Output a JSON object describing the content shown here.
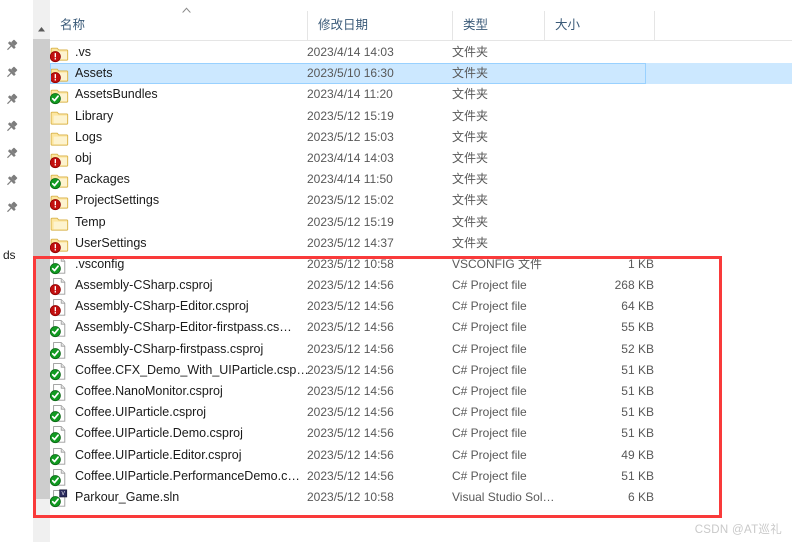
{
  "window": {
    "scrollbar_up_arrow": "▲",
    "sort_indicator": "▲",
    "rail_label": "ds",
    "pin_icon_name": "pin-icon",
    "pin_count": 7
  },
  "columns": {
    "name": "名称",
    "date_modified": "修改日期",
    "type": "类型",
    "size": "大小"
  },
  "rows": [
    {
      "name": ".vs",
      "date": "2023/4/14 14:03",
      "type": "文件夹",
      "size": "",
      "icon": "folder",
      "overlay": "modified",
      "selected": false
    },
    {
      "name": "Assets",
      "date": "2023/5/10 16:30",
      "type": "文件夹",
      "size": "",
      "icon": "folder",
      "overlay": "modified",
      "selected": true
    },
    {
      "name": "AssetsBundles",
      "date": "2023/4/14 11:20",
      "type": "文件夹",
      "size": "",
      "icon": "folder",
      "overlay": "normal",
      "selected": false
    },
    {
      "name": "Library",
      "date": "2023/5/12 15:19",
      "type": "文件夹",
      "size": "",
      "icon": "folder",
      "overlay": "none",
      "selected": false
    },
    {
      "name": "Logs",
      "date": "2023/5/12 15:03",
      "type": "文件夹",
      "size": "",
      "icon": "folder",
      "overlay": "none",
      "selected": false
    },
    {
      "name": "obj",
      "date": "2023/4/14 14:03",
      "type": "文件夹",
      "size": "",
      "icon": "folder",
      "overlay": "modified",
      "selected": false
    },
    {
      "name": "Packages",
      "date": "2023/4/14 11:50",
      "type": "文件夹",
      "size": "",
      "icon": "folder",
      "overlay": "normal",
      "selected": false
    },
    {
      "name": "ProjectSettings",
      "date": "2023/5/12 15:02",
      "type": "文件夹",
      "size": "",
      "icon": "folder",
      "overlay": "modified",
      "selected": false
    },
    {
      "name": "Temp",
      "date": "2023/5/12 15:19",
      "type": "文件夹",
      "size": "",
      "icon": "folder",
      "overlay": "none",
      "selected": false
    },
    {
      "name": "UserSettings",
      "date": "2023/5/12 14:37",
      "type": "文件夹",
      "size": "",
      "icon": "folder",
      "overlay": "modified",
      "selected": false
    },
    {
      "name": ".vsconfig",
      "date": "2023/5/12 10:58",
      "type": "VSCONFIG 文件",
      "size": "1 KB",
      "icon": "file",
      "overlay": "normal",
      "selected": false
    },
    {
      "name": "Assembly-CSharp.csproj",
      "date": "2023/5/12 14:56",
      "type": "C# Project file",
      "size": "268 KB",
      "icon": "file",
      "overlay": "modified",
      "selected": false
    },
    {
      "name": "Assembly-CSharp-Editor.csproj",
      "date": "2023/5/12 14:56",
      "type": "C# Project file",
      "size": "64 KB",
      "icon": "file",
      "overlay": "modified",
      "selected": false
    },
    {
      "name": "Assembly-CSharp-Editor-firstpass.cs…",
      "date": "2023/5/12 14:56",
      "type": "C# Project file",
      "size": "55 KB",
      "icon": "file",
      "overlay": "normal",
      "selected": false
    },
    {
      "name": "Assembly-CSharp-firstpass.csproj",
      "date": "2023/5/12 14:56",
      "type": "C# Project file",
      "size": "52 KB",
      "icon": "file",
      "overlay": "normal",
      "selected": false
    },
    {
      "name": "Coffee.CFX_Demo_With_UIParticle.csp…",
      "date": "2023/5/12 14:56",
      "type": "C# Project file",
      "size": "51 KB",
      "icon": "file",
      "overlay": "normal",
      "selected": false
    },
    {
      "name": "Coffee.NanoMonitor.csproj",
      "date": "2023/5/12 14:56",
      "type": "C# Project file",
      "size": "51 KB",
      "icon": "file",
      "overlay": "normal",
      "selected": false
    },
    {
      "name": "Coffee.UIParticle.csproj",
      "date": "2023/5/12 14:56",
      "type": "C# Project file",
      "size": "51 KB",
      "icon": "file",
      "overlay": "normal",
      "selected": false
    },
    {
      "name": "Coffee.UIParticle.Demo.csproj",
      "date": "2023/5/12 14:56",
      "type": "C# Project file",
      "size": "51 KB",
      "icon": "file",
      "overlay": "normal",
      "selected": false
    },
    {
      "name": "Coffee.UIParticle.Editor.csproj",
      "date": "2023/5/12 14:56",
      "type": "C# Project file",
      "size": "49 KB",
      "icon": "file",
      "overlay": "normal",
      "selected": false
    },
    {
      "name": "Coffee.UIParticle.PerformanceDemo.c…",
      "date": "2023/5/12 14:56",
      "type": "C# Project file",
      "size": "51 KB",
      "icon": "file",
      "overlay": "normal",
      "selected": false
    },
    {
      "name": "Parkour_Game.sln",
      "date": "2023/5/12 10:58",
      "type": "Visual Studio Sol…",
      "size": "6 KB",
      "icon": "sln",
      "overlay": "normal",
      "selected": false
    }
  ],
  "annotation": {
    "highlight_color": "#f93a3a",
    "first_highlighted_row": ".vsconfig",
    "last_highlighted_row": "Parkour_Game.sln"
  },
  "watermark": "CSDN @AT巡礼"
}
